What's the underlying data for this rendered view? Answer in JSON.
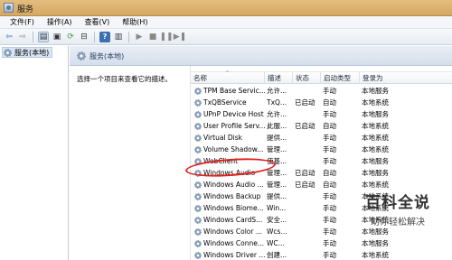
{
  "window": {
    "title": "服务"
  },
  "menu": [
    "文件(F)",
    "操作(A)",
    "查看(V)",
    "帮助(H)"
  ],
  "tree": {
    "item": "服务(本地)"
  },
  "header": {
    "title": "服务(本地)"
  },
  "description_pane": {
    "text": "选择一个项目来查看它的描述。"
  },
  "columns": {
    "name": "名称",
    "desc": "描述",
    "status": "状态",
    "startup": "启动类型",
    "logon": "登录为"
  },
  "services": [
    {
      "name": "TPM Base Servic...",
      "desc": "允许...",
      "status": "",
      "startup": "手动",
      "logon": "本地服务"
    },
    {
      "name": "TxQBService",
      "desc": "TxQ...",
      "status": "已启动",
      "startup": "自动",
      "logon": "本地系统"
    },
    {
      "name": "UPnP Device Host",
      "desc": "允许...",
      "status": "",
      "startup": "手动",
      "logon": "本地服务"
    },
    {
      "name": "User Profile Serv...",
      "desc": "此服...",
      "status": "已启动",
      "startup": "自动",
      "logon": "本地系统"
    },
    {
      "name": "Virtual Disk",
      "desc": "提供...",
      "status": "",
      "startup": "手动",
      "logon": "本地系统"
    },
    {
      "name": "Volume Shadow...",
      "desc": "管理...",
      "status": "",
      "startup": "手动",
      "logon": "本地系统"
    },
    {
      "name": "WebClient",
      "desc": "使基...",
      "status": "",
      "startup": "手动",
      "logon": "本地服务"
    },
    {
      "name": "Windows Audio",
      "desc": "管理...",
      "status": "已启动",
      "startup": "自动",
      "logon": "本地服务"
    },
    {
      "name": "Windows Audio ...",
      "desc": "管理...",
      "status": "已启动",
      "startup": "自动",
      "logon": "本地系统"
    },
    {
      "name": "Windows Backup",
      "desc": "提供...",
      "status": "",
      "startup": "手动",
      "logon": "本地系统"
    },
    {
      "name": "Windows Biome...",
      "desc": "Win...",
      "status": "",
      "startup": "手动",
      "logon": "本地系统"
    },
    {
      "name": "Windows CardS...",
      "desc": "安全...",
      "status": "",
      "startup": "手动",
      "logon": "本地系统"
    },
    {
      "name": "Windows Color ...",
      "desc": "Wcs...",
      "status": "",
      "startup": "手动",
      "logon": "本地服务"
    },
    {
      "name": "Windows Conne...",
      "desc": "WC...",
      "status": "",
      "startup": "手动",
      "logon": "本地服务"
    },
    {
      "name": "Windows Driver ...",
      "desc": "创建...",
      "status": "",
      "startup": "手动",
      "logon": "本地系统"
    }
  ],
  "highlighted_service": "Windows Audio",
  "watermark": {
    "main": "百科全说",
    "sub": "助你轻松解决"
  },
  "colors": {
    "titlebar": "#d9ad69",
    "highlight": "#e0221d"
  }
}
